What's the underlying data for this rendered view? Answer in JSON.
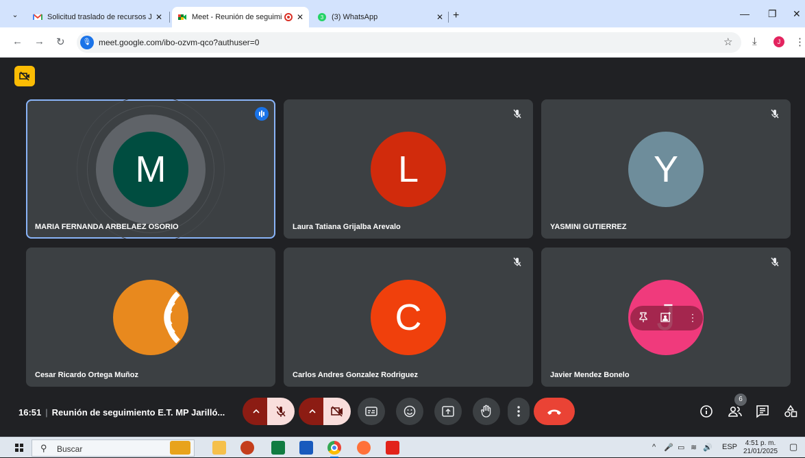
{
  "browser": {
    "tabs": [
      {
        "title": "Solicitud traslado de recursos Ja",
        "close": "✕"
      },
      {
        "title": "Meet - Reunión de seguimie",
        "close": "✕"
      },
      {
        "title": "(3) WhatsApp",
        "close": "✕",
        "badge": "3"
      }
    ],
    "new_tab": "+",
    "window": {
      "minimize": "—",
      "restore": "❐",
      "close": "✕"
    },
    "url": "meet.google.com/ibo-ozvm-qco?authuser=0",
    "profile_initial": "J"
  },
  "meet": {
    "participants": [
      {
        "name": "MARIA FERNANDA ARBELAEZ OSORIO",
        "initial": "M",
        "color": "#004d40",
        "speaking": true
      },
      {
        "name": "Laura Tatiana Grijalba Arevalo",
        "initial": "L",
        "color": "#d12b0c",
        "muted": true
      },
      {
        "name": "YASMINI GUTIERREZ",
        "initial": "Y",
        "color": "#6e8d9b",
        "muted": true
      },
      {
        "name": "Cesar Ricardo Ortega Muñoz",
        "avatar": "logo-orange-waves"
      },
      {
        "name": "Carlos Andres Gonzalez Rodriguez",
        "initial": "C",
        "color": "#f0400c",
        "muted": true
      },
      {
        "name": "Javier Mendez Bonelo",
        "initial": "J",
        "color": "#f03a7c",
        "muted": true
      }
    ],
    "clock": "16:51",
    "separator": "|",
    "meeting_title": "Reunión de seguimiento E.T. MP Jarilló...",
    "participant_count": "6",
    "colors": {
      "mic_off_dark": "#8c1c13",
      "mic_off_light": "#f9dedc",
      "hangup": "#ea4335",
      "tile": "#3c4043",
      "speaking_border": "#8ab4f8"
    }
  },
  "taskbar": {
    "search_placeholder": "Buscar",
    "language": "ESP",
    "time": "4:51 p. m.",
    "date": "21/01/2025"
  }
}
